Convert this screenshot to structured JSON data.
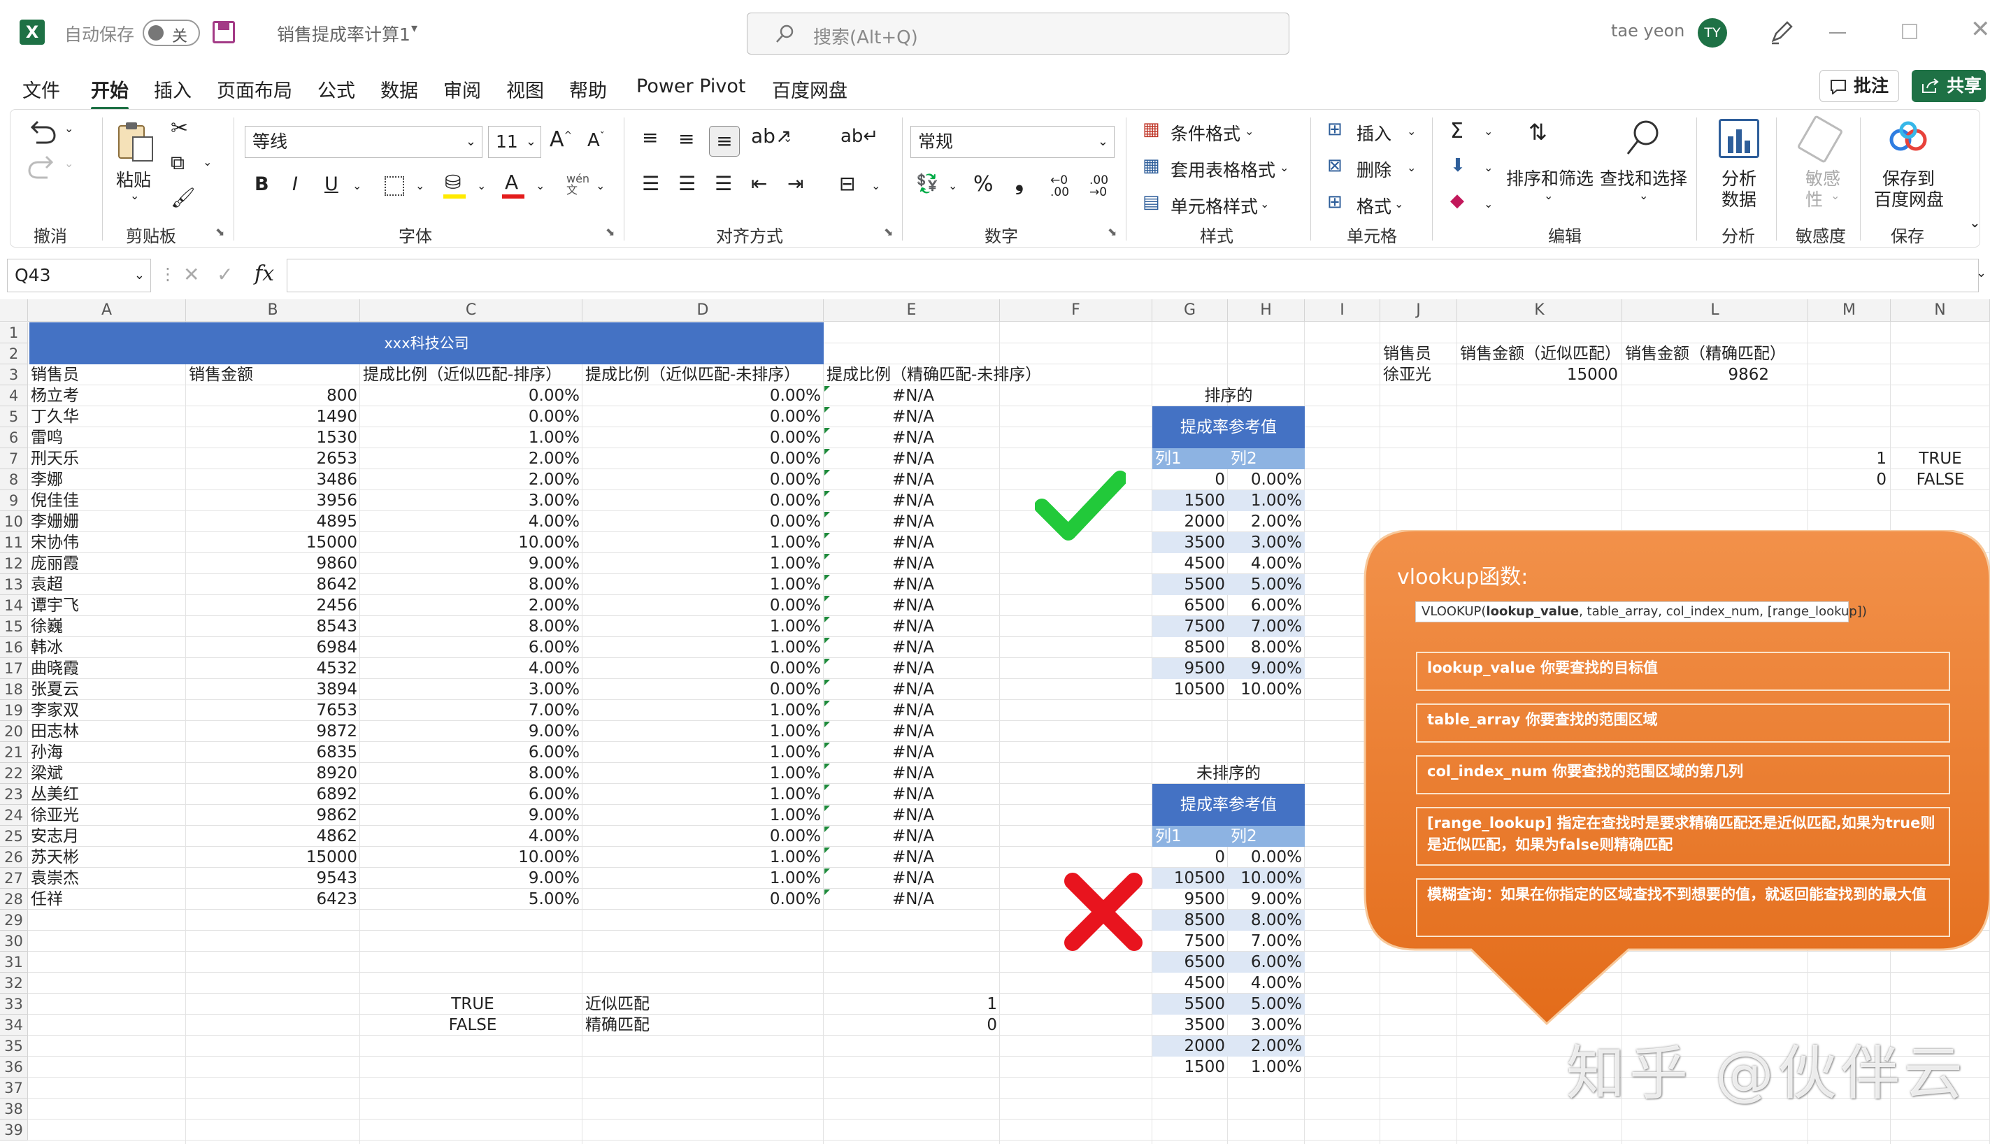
{
  "titlebar": {
    "autosave_label": "自动保存",
    "autosave_state": "关",
    "doc_title": "销售提成率计算1",
    "search_placeholder": "搜索(Alt+Q)",
    "user_name": "tae yeon",
    "user_initials": "TY"
  },
  "menu": {
    "tabs": [
      "文件",
      "开始",
      "插入",
      "页面布局",
      "公式",
      "数据",
      "审阅",
      "视图",
      "帮助",
      "Power Pivot",
      "百度网盘"
    ],
    "comments_label": "批注",
    "share_label": "共享"
  },
  "ribbon": {
    "groups": {
      "undo": "撤消",
      "clipboard": "剪贴板",
      "font": "字体",
      "align": "对齐方式",
      "number": "数字",
      "styles": "样式",
      "cells": "单元格",
      "edit": "编辑",
      "analyze": "分析",
      "sensitivity": "敏感度",
      "save": "保存"
    },
    "paste": "粘贴",
    "font_name": "等线",
    "font_size": "11",
    "number_format": "常规",
    "cond_format": "条件格式",
    "table_format": "套用表格格式",
    "cell_style": "单元格样式",
    "insert": "插入",
    "delete": "删除",
    "format": "格式",
    "sort_filter": "排序和筛选",
    "find_select": "查找和选择",
    "analyze_data": [
      "分析",
      "数据"
    ],
    "sensitivity_btn": [
      "敏感",
      "性"
    ],
    "save_baidu": [
      "保存到",
      "百度网盘"
    ],
    "wen": "wén",
    "wen2": "文"
  },
  "formula_bar": {
    "name_box": "Q43",
    "fx": "fx",
    "formula": ""
  },
  "sheet": {
    "columns": [
      "A",
      "B",
      "C",
      "D",
      "E",
      "F",
      "G",
      "H",
      "I",
      "J",
      "K",
      "L",
      "M",
      "N"
    ],
    "rows": [
      "1",
      "2",
      "3",
      "4",
      "5",
      "6",
      "7",
      "8",
      "9",
      "10",
      "11",
      "12",
      "13",
      "14",
      "15",
      "16",
      "17",
      "18",
      "19",
      "20",
      "21",
      "22",
      "23",
      "24",
      "25",
      "26",
      "27",
      "28",
      "29",
      "30",
      "31",
      "32",
      "33",
      "34",
      "35",
      "36",
      "37",
      "38",
      "39"
    ],
    "company_title": "xxx科技公司",
    "headers": [
      "销售员",
      "销售金额",
      "提成比例（近似匹配-排序）",
      "提成比例（近似匹配-未排序）",
      "提成比例（精确匹配-未排序）"
    ],
    "data": [
      [
        "杨立考",
        "800",
        "0.00%",
        "0.00%",
        "#N/A"
      ],
      [
        "丁久华",
        "1490",
        "0.00%",
        "0.00%",
        "#N/A"
      ],
      [
        "雷鸣",
        "1530",
        "1.00%",
        "0.00%",
        "#N/A"
      ],
      [
        "刑天乐",
        "2653",
        "2.00%",
        "0.00%",
        "#N/A"
      ],
      [
        "李娜",
        "3486",
        "2.00%",
        "0.00%",
        "#N/A"
      ],
      [
        "倪佳佳",
        "3956",
        "3.00%",
        "0.00%",
        "#N/A"
      ],
      [
        "李姗姗",
        "4895",
        "4.00%",
        "0.00%",
        "#N/A"
      ],
      [
        "宋协伟",
        "15000",
        "10.00%",
        "1.00%",
        "#N/A"
      ],
      [
        "庞丽霞",
        "9860",
        "9.00%",
        "1.00%",
        "#N/A"
      ],
      [
        "袁超",
        "8642",
        "8.00%",
        "1.00%",
        "#N/A"
      ],
      [
        "谭宇飞",
        "2456",
        "2.00%",
        "0.00%",
        "#N/A"
      ],
      [
        "徐巍",
        "8543",
        "8.00%",
        "1.00%",
        "#N/A"
      ],
      [
        "韩冰",
        "6984",
        "6.00%",
        "1.00%",
        "#N/A"
      ],
      [
        "曲晓霞",
        "4532",
        "4.00%",
        "0.00%",
        "#N/A"
      ],
      [
        "张夏云",
        "3894",
        "3.00%",
        "0.00%",
        "#N/A"
      ],
      [
        "李家双",
        "7653",
        "7.00%",
        "1.00%",
        "#N/A"
      ],
      [
        "田志林",
        "9872",
        "9.00%",
        "1.00%",
        "#N/A"
      ],
      [
        "孙海",
        "6835",
        "6.00%",
        "1.00%",
        "#N/A"
      ],
      [
        "梁斌",
        "8920",
        "8.00%",
        "1.00%",
        "#N/A"
      ],
      [
        "丛美红",
        "6892",
        "6.00%",
        "1.00%",
        "#N/A"
      ],
      [
        "徐亚光",
        "9862",
        "9.00%",
        "1.00%",
        "#N/A"
      ],
      [
        "安志月",
        "4862",
        "4.00%",
        "0.00%",
        "#N/A"
      ],
      [
        "苏天彬",
        "15000",
        "10.00%",
        "1.00%",
        "#N/A"
      ],
      [
        "袁崇杰",
        "9543",
        "9.00%",
        "1.00%",
        "#N/A"
      ],
      [
        "任祥",
        "6423",
        "5.00%",
        "0.00%",
        "#N/A"
      ]
    ],
    "legend": [
      [
        "TRUE",
        "近似匹配",
        "1"
      ],
      [
        "FALSE",
        "精确匹配",
        "0"
      ]
    ],
    "sorted_title": "排序的",
    "unsorted_title": "未排序的",
    "ref_header": "提成率参考值",
    "ref_cols": [
      "列1",
      "列2"
    ],
    "sorted_ref": [
      [
        "0",
        "0.00%"
      ],
      [
        "1500",
        "1.00%"
      ],
      [
        "2000",
        "2.00%"
      ],
      [
        "3500",
        "3.00%"
      ],
      [
        "4500",
        "4.00%"
      ],
      [
        "5500",
        "5.00%"
      ],
      [
        "6500",
        "6.00%"
      ],
      [
        "7500",
        "7.00%"
      ],
      [
        "8500",
        "8.00%"
      ],
      [
        "9500",
        "9.00%"
      ],
      [
        "10500",
        "10.00%"
      ]
    ],
    "unsorted_ref": [
      [
        "0",
        "0.00%"
      ],
      [
        "10500",
        "10.00%"
      ],
      [
        "9500",
        "9.00%"
      ],
      [
        "8500",
        "8.00%"
      ],
      [
        "7500",
        "7.00%"
      ],
      [
        "6500",
        "6.00%"
      ],
      [
        "4500",
        "4.00%"
      ],
      [
        "5500",
        "5.00%"
      ],
      [
        "3500",
        "3.00%"
      ],
      [
        "2000",
        "2.00%"
      ],
      [
        "1500",
        "1.00%"
      ]
    ],
    "lookup_headers": [
      "销售员",
      "销售金额（近似匹配）",
      "销售金额（精确匹配）"
    ],
    "lookup_row": [
      "徐亚光",
      "15000",
      "9862"
    ],
    "mn": [
      [
        "1",
        "TRUE"
      ],
      [
        "0",
        "FALSE"
      ]
    ]
  },
  "callout": {
    "title": "vlookup函数:",
    "syntax_prefix": "VLOOKUP(",
    "syntax_bold": "lookup_value",
    "syntax_rest": ", table_array, col_index_num, [range_lookup])",
    "items": [
      "lookup_value  你要查找的目标值",
      "table_array  你要查找的范围区域",
      "col_index_num 你要查找的范围区域的第几列",
      "[range_lookup] 指定在查找时是要求精确匹配还是近似匹配,如果为true则是近似匹配，如果为false则精确匹配",
      "模糊查询：如果在你指定的区域查找不到想要的值，就返回能查找到的最大值"
    ]
  },
  "watermark": "知乎 @伙伴云",
  "colors": {
    "excel_green": "#1e7145",
    "header_blue": "#4472c4",
    "band_blue": "#dde7f5",
    "callout_orange": "#ee7d31",
    "check_green": "#22c93a",
    "cross_red": "#e8141e"
  }
}
